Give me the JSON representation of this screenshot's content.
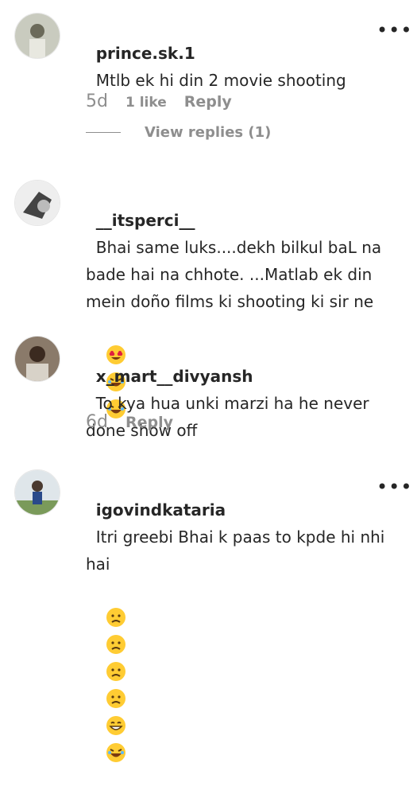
{
  "comments": [
    {
      "username": "prince.sk.1",
      "text": "Mtlb ek hi din 2 movie shooting",
      "time": "5d",
      "likes": "1 like",
      "reply_label": "Reply",
      "view_replies": "View replies (1)"
    },
    {
      "username": "__itsperci__",
      "text": "Bhai same luks....dekh bilkul baL na bade hai na chhote. ...Matlab ek din mein doño films ki shooting ki sir ne",
      "emojis": [
        "heart-eyes-emoji",
        "laughing-emoji",
        "laughing-emoji"
      ]
    },
    {
      "username": "x_mart__divyansh",
      "text": "To kya hua unki marzi ha he never done show off",
      "time": "6d",
      "reply_label": "Reply"
    },
    {
      "username": "igovindkataria",
      "text": "Itri greebi Bhai k paas to kpde hi nhi hai",
      "emojis": [
        "sad-emoji",
        "sad-emoji",
        "sad-emoji",
        "sad-emoji",
        "grinning-emoji",
        "laughing-emoji"
      ]
    }
  ],
  "colors": {
    "text": "#262626",
    "secondary": "#8e8e8e",
    "emoji": "#ffcc33"
  }
}
